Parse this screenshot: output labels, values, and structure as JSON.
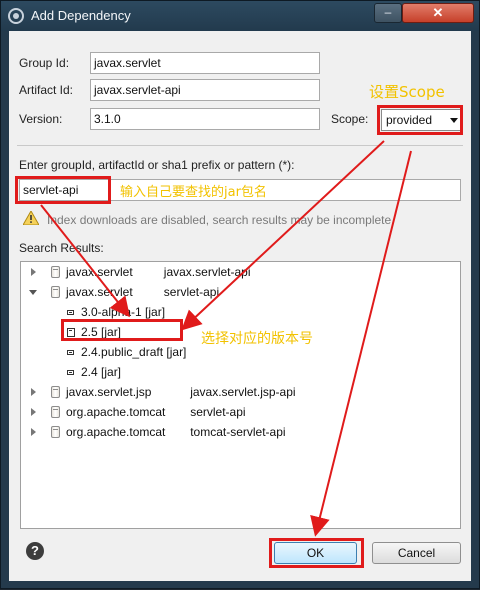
{
  "window": {
    "title": "Add Dependency",
    "minimize_glyph": "–",
    "close_glyph": "✕"
  },
  "form": {
    "group_id_label": "Group Id:",
    "group_id_value": "javax.servlet",
    "artifact_id_label": "Artifact Id:",
    "artifact_id_value": "javax.servlet-api",
    "version_label": "Version:",
    "version_value": "3.1.0",
    "scope_label": "Scope:",
    "scope_value": "provided",
    "search_label": "Enter groupId, artifactId or sha1 prefix or pattern (*):",
    "search_value": "servlet-api",
    "warning": "Index downloads are disabled, search results may be incomplete."
  },
  "results": {
    "label": "Search Results:",
    "rows": [
      {
        "group": "javax.servlet",
        "artifact": "javax.servlet-api",
        "expanded": false
      },
      {
        "group": "javax.servlet",
        "artifact": "servlet-api",
        "expanded": true
      },
      {
        "version": "3.0-alpha-1 [jar]"
      },
      {
        "version": "2.5 [jar]",
        "selected": true
      },
      {
        "version": "2.4.public_draft [jar]"
      },
      {
        "version": "2.4 [jar]"
      },
      {
        "group": "javax.servlet.jsp",
        "artifact": "javax.servlet.jsp-api",
        "expanded": false
      },
      {
        "group": "org.apache.tomcat",
        "artifact": "servlet-api",
        "expanded": false
      },
      {
        "group": "org.apache.tomcat",
        "artifact": "tomcat-servlet-api",
        "expanded": false
      }
    ]
  },
  "buttons": {
    "help": "?",
    "ok": "OK",
    "cancel": "Cancel"
  },
  "annotations": {
    "scope_note": "设置Scope",
    "search_note": "输入自己要查找的jar包名",
    "version_note": "选择对应的版本号",
    "color": "#f2c200",
    "box_color": "#e01b1b"
  }
}
